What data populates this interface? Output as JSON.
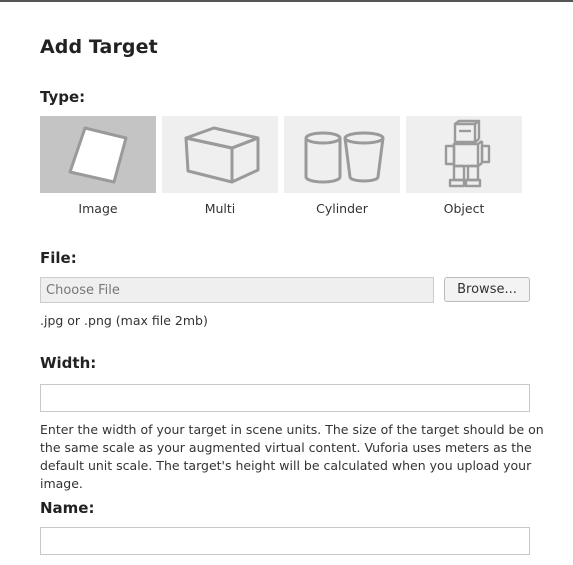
{
  "dialog": {
    "title": "Add Target"
  },
  "type_section": {
    "label": "Type:",
    "selected": "Image",
    "options": [
      {
        "label": "Image",
        "icon": "image-target-icon"
      },
      {
        "label": "Multi",
        "icon": "multi-box-icon"
      },
      {
        "label": "Cylinder",
        "icon": "cylinder-icon"
      },
      {
        "label": "Object",
        "icon": "object-robot-icon"
      }
    ]
  },
  "file_section": {
    "label": "File:",
    "placeholder": "Choose File",
    "browse_label": "Browse...",
    "hint": ".jpg or .png (max file 2mb)"
  },
  "width_section": {
    "label": "Width:",
    "value": "",
    "help": "Enter the width of your target in scene units. The size of the target should be on the same scale as your augmented virtual content. Vuforia uses meters as the default unit scale. The target's height will be calculated when you upload your image."
  },
  "name_section": {
    "label": "Name:",
    "value": ""
  },
  "colors": {
    "selected_tile": "#c4c4c4",
    "tile": "#efefef",
    "icon_stroke": "#999999"
  }
}
